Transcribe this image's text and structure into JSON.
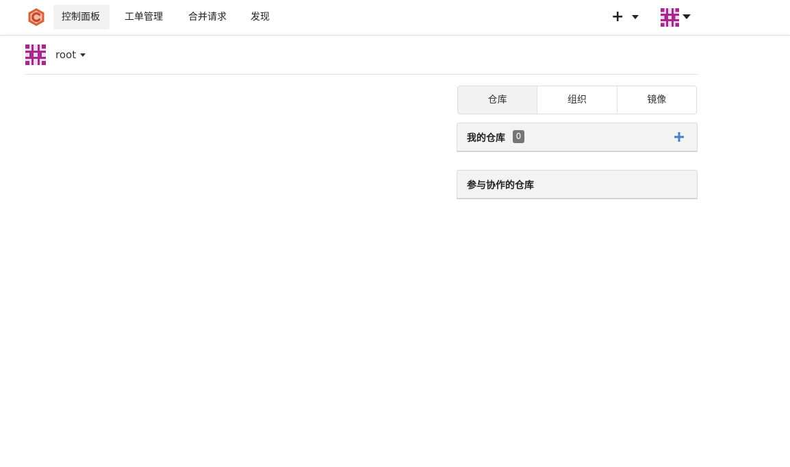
{
  "navbar": {
    "logo_icon": "gitea-logo-icon",
    "items": [
      {
        "label": "控制面板",
        "active": true
      },
      {
        "label": "工单管理",
        "active": false
      },
      {
        "label": "合并请求",
        "active": false
      },
      {
        "label": "发现",
        "active": false
      }
    ],
    "create_icon": "plus-icon",
    "user_avatar_icon": "identicon-avatar-icon"
  },
  "context": {
    "username": "root",
    "avatar_icon": "identicon-avatar-icon"
  },
  "dashboard": {
    "tabs": [
      {
        "label": "仓库",
        "active": true
      },
      {
        "label": "组织",
        "active": false
      },
      {
        "label": "镜像",
        "active": false
      }
    ],
    "my_repos": {
      "title": "我的仓库",
      "count": "0",
      "add_icon": "plus-icon"
    },
    "collab_repos": {
      "title": "参与协作的仓库"
    }
  },
  "colors": {
    "brand": "#d0502e",
    "avatar": "#a6278e",
    "accent": "#4183c4",
    "badge": "#767676"
  }
}
